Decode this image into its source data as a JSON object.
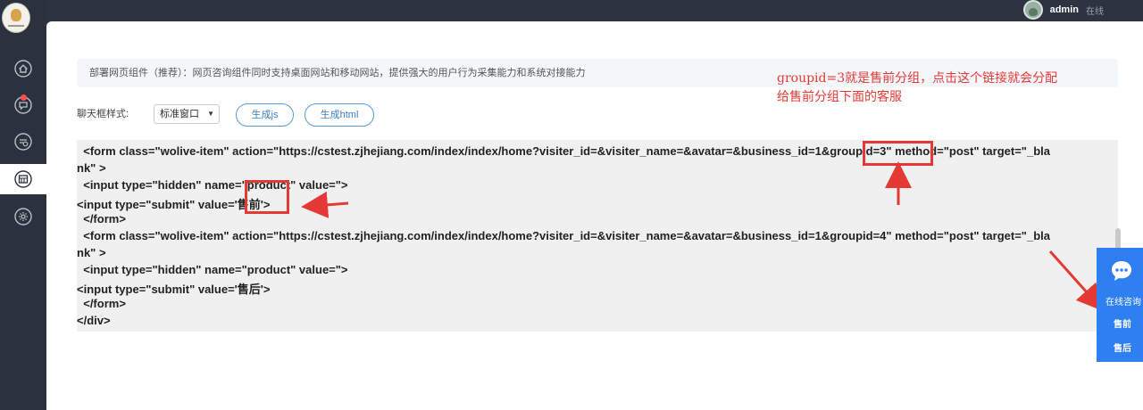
{
  "header": {
    "username": "admin",
    "status": "在线"
  },
  "sidebar": {
    "items": [
      {
        "icon": "home-icon"
      },
      {
        "icon": "message-icon",
        "badge": true
      },
      {
        "icon": "history-icon"
      },
      {
        "icon": "widget-icon",
        "active": true
      },
      {
        "icon": "gear-icon"
      }
    ]
  },
  "main": {
    "notice": "部署网页组件（推荐）：网页咨询组件同时支持桌面网站和移动网站，提供强大的用户行为采集能力和系统对接能力",
    "style_label": "聊天框样式:",
    "style_select": "标准窗口",
    "buttons": {
      "gen_js": "生成js",
      "gen_html": "生成html"
    },
    "code_lines": [
      "  <form class=\"wolive-item\" action=\"https://cstest.zjhejiang.com/index/index/home?visiter_id=&visiter_name=&avatar=&business_id=1&groupid=3\" method=\"post\" target=\"_bla",
      "nk\" >",
      "  <input type=\"hidden\" name=\"product\" value=\">",
      "<input type=\"submit\" value='售前'>",
      "  </form>",
      "  <form class=\"wolive-item\" action=\"https://cstest.zjhejiang.com/index/index/home?visiter_id=&visiter_name=&avatar=&business_id=1&groupid=4\" method=\"post\" target=\"_bla",
      "nk\" >",
      "  <input type=\"hidden\" name=\"product\" value=\">",
      "<input type=\"submit\" value='售后'>",
      "  </form>",
      "</div>"
    ]
  },
  "annotation": {
    "line1": "groupid=3就是售前分组，点击这个链接就会分配",
    "line2": "给售前分组下面的客服"
  },
  "widget": {
    "title": "在线咨询",
    "pre_sales": "售前",
    "after_sales": "售后"
  },
  "colors": {
    "sidebar": "#2b313d",
    "accent": "#2e7ff0",
    "annotation": "#e53935"
  }
}
